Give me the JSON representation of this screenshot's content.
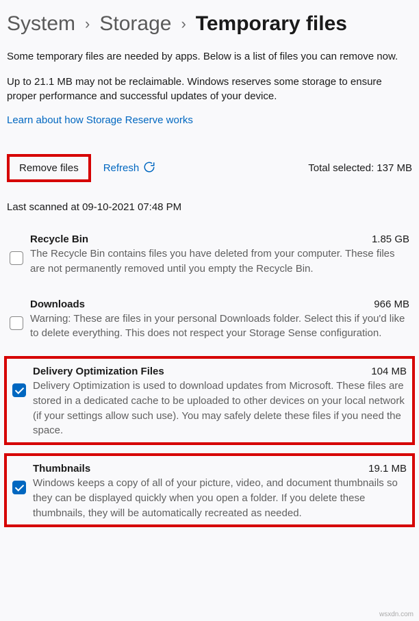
{
  "breadcrumb": {
    "level1": "System",
    "level2": "Storage",
    "current": "Temporary files"
  },
  "intro": {
    "p1": "Some temporary files are needed by apps. Below is a list of files you can remove now.",
    "p2": "Up to 21.1 MB may not be reclaimable. Windows reserves some storage to ensure proper performance and successful updates of your device."
  },
  "link_text": "Learn about how Storage Reserve works",
  "actions": {
    "remove_label": "Remove files",
    "refresh_label": "Refresh",
    "total_prefix": "Total selected: ",
    "total_value": "137 MB"
  },
  "last_scanned": "Last scanned at 09-10-2021 07:48 PM",
  "items": [
    {
      "title": "Recycle Bin",
      "size": "1.85 GB",
      "desc": "The Recycle Bin contains files you have deleted from your computer. These files are not permanently removed until you empty the Recycle Bin.",
      "checked": false
    },
    {
      "title": "Downloads",
      "size": "966 MB",
      "desc": "Warning: These are files in your personal Downloads folder. Select this if you'd like to delete everything. This does not respect your Storage Sense configuration.",
      "checked": false
    },
    {
      "title": "Delivery Optimization Files",
      "size": "104 MB",
      "desc": "Delivery Optimization is used to download updates from Microsoft. These files are stored in a dedicated cache to be uploaded to other devices on your local network (if your settings allow such use). You may safely delete these files if you need the space.",
      "checked": true
    },
    {
      "title": "Thumbnails",
      "size": "19.1 MB",
      "desc": "Windows keeps a copy of all of your picture, video, and document thumbnails so they can be displayed quickly when you open a folder. If you delete these thumbnails, they will be automatically recreated as needed.",
      "checked": true
    }
  ],
  "watermark": "wsxdn.com"
}
